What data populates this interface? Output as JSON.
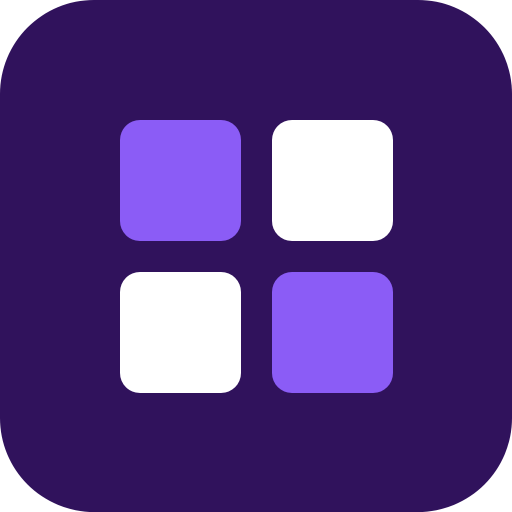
{
  "icon": {
    "name": "app-grid-icon",
    "colors": {
      "background": "#30125C",
      "accent": "#8B5CF6",
      "light": "#FFFFFF"
    }
  },
  "tiles": [
    {
      "name": "top-left-tile",
      "color": "#8B5CF6"
    },
    {
      "name": "top-right-tile",
      "color": "#FFFFFF"
    },
    {
      "name": "bottom-left-tile",
      "color": "#FFFFFF"
    },
    {
      "name": "bottom-right-tile",
      "color": "#8B5CF6"
    }
  ]
}
